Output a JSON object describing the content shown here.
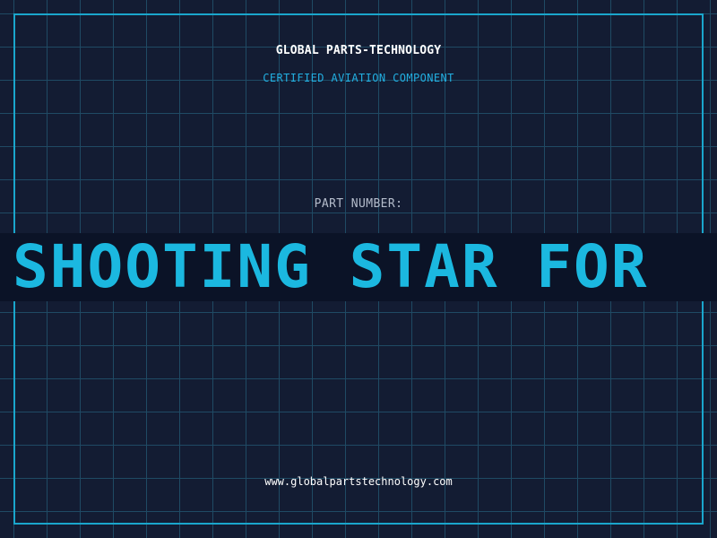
{
  "header": {
    "brand": "GLOBAL PARTS-TECHNOLOGY",
    "subtitle": "CERTIFIED AVIATION COMPONENT"
  },
  "part": {
    "label": "PART NUMBER:",
    "value": "SHOOTING STAR FOR"
  },
  "footer": {
    "website": "www.globalpartstechnology.com"
  },
  "colors": {
    "background": "#131c33",
    "grid": "#1f4a64",
    "frame": "#1aa6cc",
    "accent": "#1bb8e0",
    "banner": "#0b1327"
  }
}
